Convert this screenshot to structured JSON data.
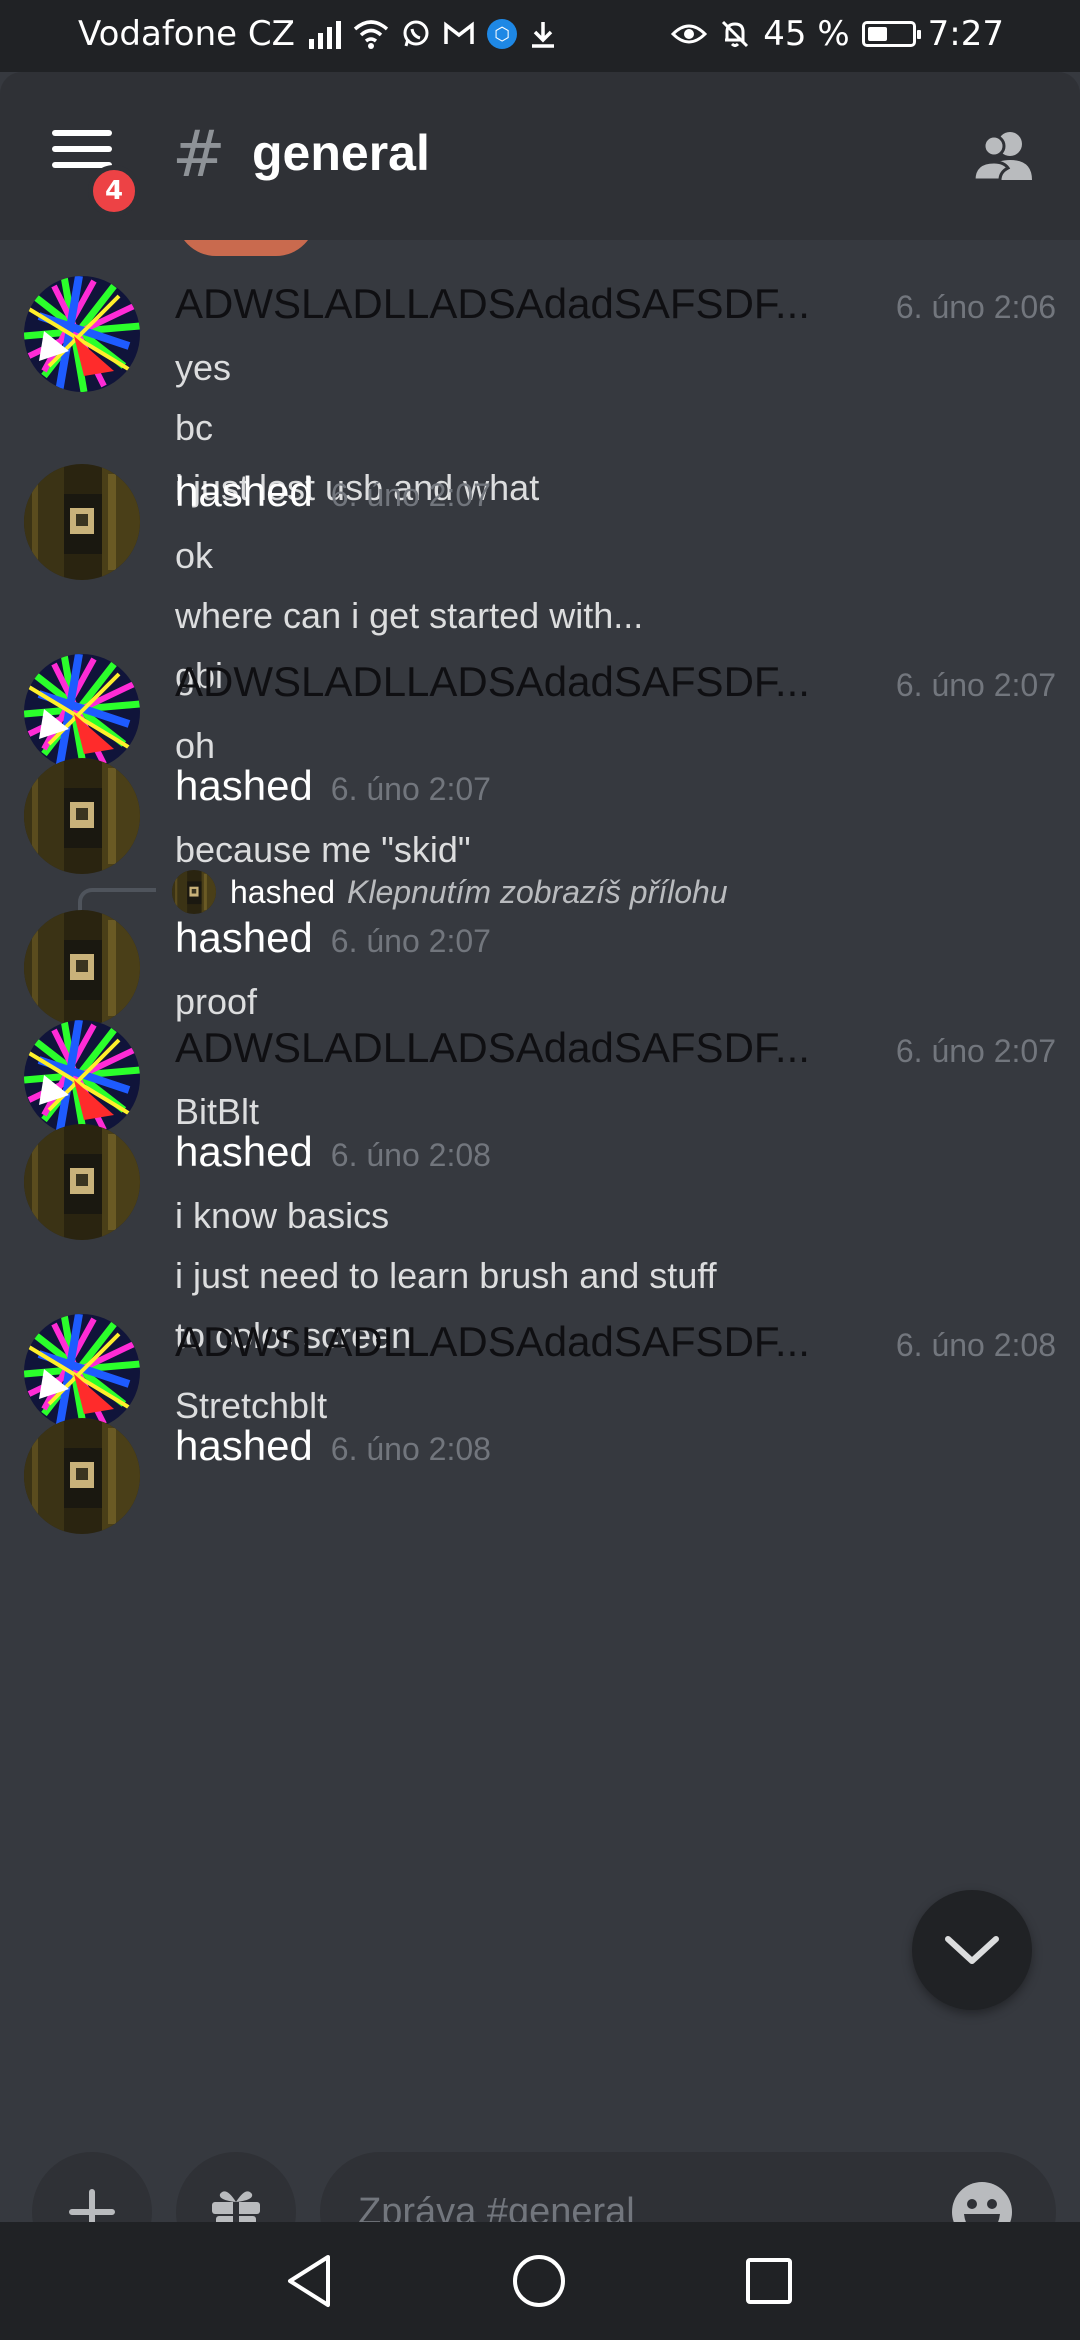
{
  "status_bar": {
    "carrier": "Vodafone CZ",
    "battery": "45 %",
    "battery_level": 0.45,
    "time": "7:27",
    "icons": [
      "signal-icon",
      "wifi-icon",
      "whatsapp-icon",
      "gmail-icon",
      "app-badge-icon",
      "download-icon",
      "eye-comfort-icon",
      "notifications-off-icon",
      "battery-icon"
    ]
  },
  "header": {
    "menu_badge": "4",
    "hash": "#",
    "channel": "general"
  },
  "messages": [
    {
      "author": "ADWSLADLLADSAdadSAFSDF...",
      "time": "6. úno 2:06",
      "avatar": "glitch",
      "lines": [
        "yes",
        "bc",
        "i just lost usb and what"
      ]
    },
    {
      "author": "hashed",
      "time": "6. úno 2:07",
      "avatar": "photo",
      "lines": [
        "ok",
        "where can i get started with...",
        "gbi"
      ]
    },
    {
      "author": "ADWSLADLLADSAdadSAFSDF...",
      "time": "6. úno 2:07",
      "avatar": "glitch",
      "lines": [
        "oh"
      ]
    },
    {
      "author": "hashed",
      "time": "6. úno 2:07",
      "avatar": "photo",
      "lines": [
        "because me \"skid\""
      ]
    },
    {
      "author": "hashed",
      "time": "6. úno 2:07",
      "avatar": "photo",
      "lines": [
        "proof"
      ],
      "reply": {
        "author": "hashed",
        "text": "Klepnutím zobrazíš přílohu"
      }
    },
    {
      "author": "ADWSLADLLADSAdadSAFSDF...",
      "time": "6. úno 2:07",
      "avatar": "glitch",
      "lines": [
        "BitBlt"
      ]
    },
    {
      "author": "hashed",
      "time": "6. úno 2:08",
      "avatar": "photo",
      "lines": [
        "i know basics",
        "i just need to learn brush and stuff",
        "to color screen"
      ]
    },
    {
      "author": "ADWSLADLLADSAdadSAFSDF...",
      "time": "6. úno 2:08",
      "avatar": "glitch",
      "lines": [
        "Stretchblt"
      ]
    },
    {
      "author": "hashed",
      "time": "6. úno 2:08",
      "avatar": "photo",
      "lines": []
    }
  ],
  "composer": {
    "placeholder": "Zpráva #general"
  },
  "colors": {
    "background": "#36393f",
    "header": "#2f3136",
    "system_bar": "#202225",
    "badge": "#ed4245"
  }
}
